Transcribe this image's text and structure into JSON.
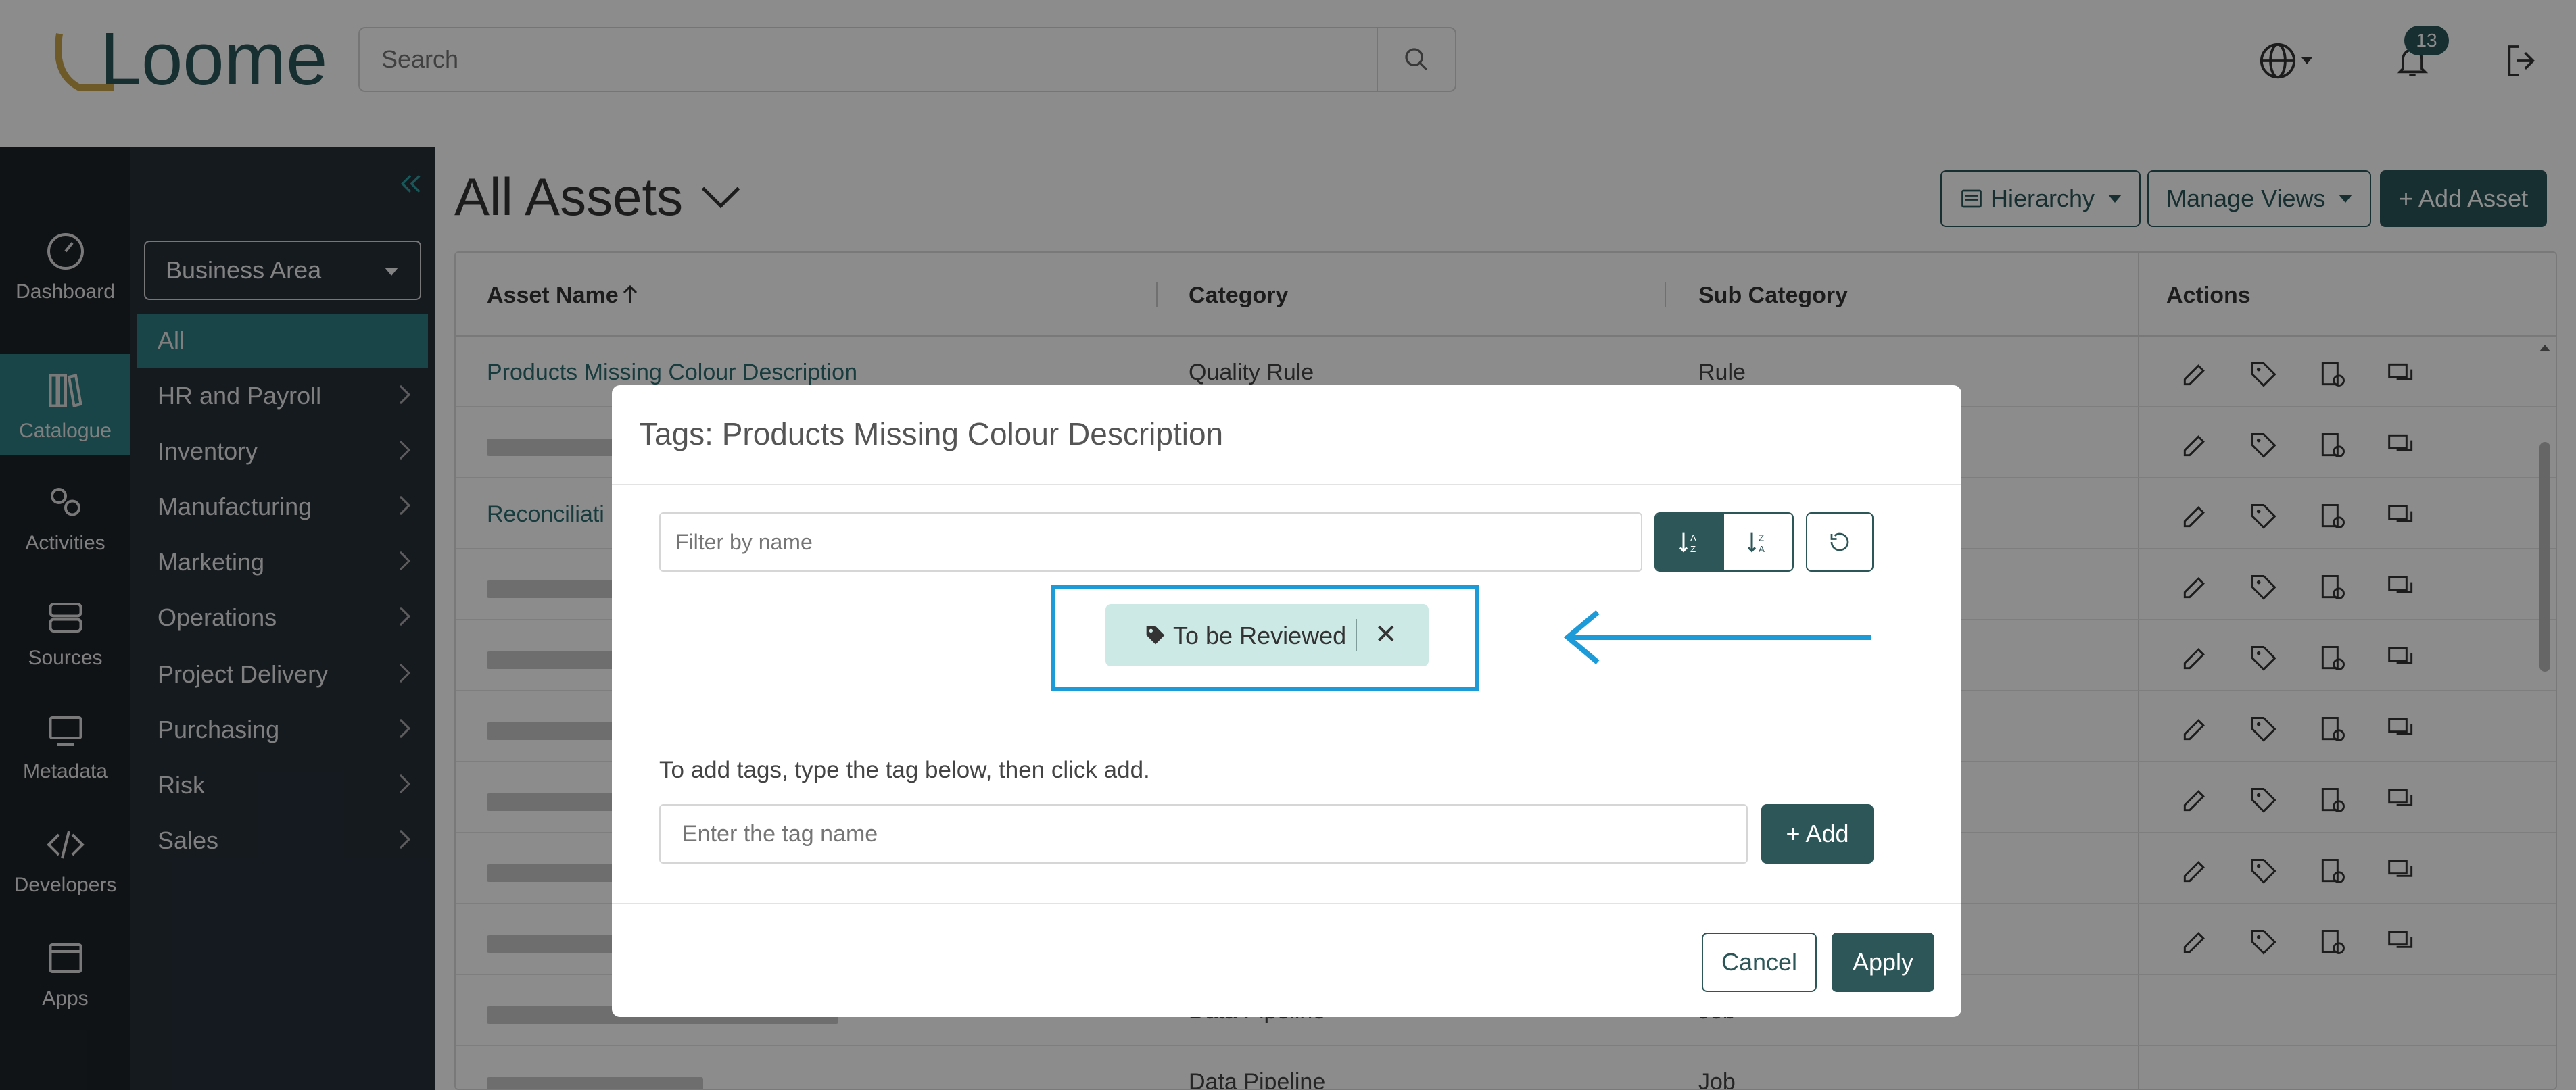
{
  "header": {
    "logo_text": "Loome",
    "search_placeholder": "Search",
    "notification_count": "13"
  },
  "leftnav": [
    {
      "label": "Dashboard",
      "icon": "dashboard-icon"
    },
    {
      "label": "Catalogue",
      "icon": "catalogue-icon",
      "active": true
    },
    {
      "label": "Activities",
      "icon": "activities-icon"
    },
    {
      "label": "Sources",
      "icon": "sources-icon"
    },
    {
      "label": "Metadata",
      "icon": "metadata-icon"
    },
    {
      "label": "Developers",
      "icon": "developers-icon"
    },
    {
      "label": "Apps",
      "icon": "apps-icon"
    }
  ],
  "subnav": {
    "selector": "Business Area",
    "items": [
      {
        "label": "All",
        "active": true
      },
      {
        "label": "HR and Payroll"
      },
      {
        "label": "Inventory"
      },
      {
        "label": "Manufacturing"
      },
      {
        "label": "Marketing"
      },
      {
        "label": "Operations"
      },
      {
        "label": "Project Delivery"
      },
      {
        "label": "Purchasing"
      },
      {
        "label": "Risk"
      },
      {
        "label": "Sales"
      }
    ]
  },
  "main": {
    "title": "All Assets",
    "buttons": {
      "hierarchy": "Hierarchy",
      "manage_views": "Manage Views",
      "add_asset": "+ Add Asset"
    },
    "columns": {
      "asset_name": "Asset Name",
      "category": "Category",
      "sub_category": "Sub Category",
      "actions": "Actions"
    },
    "rows": [
      {
        "name": "Products Missing Colour Description",
        "category": "Quality Rule",
        "sub": "Rule"
      },
      {
        "name": "",
        "category": "",
        "sub": ""
      },
      {
        "name": "Reconciliati",
        "category": "",
        "sub": ""
      },
      {
        "name": "",
        "category": "",
        "sub": ""
      },
      {
        "name": "",
        "category": "",
        "sub": ""
      },
      {
        "name": "",
        "category": "",
        "sub": ""
      },
      {
        "name": "",
        "category": "",
        "sub": ""
      },
      {
        "name": "",
        "category": "",
        "sub": ""
      },
      {
        "name": "",
        "category": "",
        "sub": ""
      },
      {
        "name": "",
        "category": "Data Pipeline",
        "sub": "Job"
      },
      {
        "name": "",
        "category": "Data Pipeline",
        "sub": "Job"
      }
    ]
  },
  "modal": {
    "title": "Tags: Products Missing Colour Description",
    "filter_placeholder": "Filter by name",
    "tag": "To be Reviewed",
    "remove_glyph": "✕",
    "help_text": "To add tags, type the tag below, then click add.",
    "tag_input_placeholder": "Enter the tag name",
    "add_label": "+ Add",
    "cancel_label": "Cancel",
    "apply_label": "Apply"
  },
  "colors": {
    "accent": "#2d5659",
    "highlight": "#1d9bd8",
    "active_nav": "#2f7f84"
  }
}
